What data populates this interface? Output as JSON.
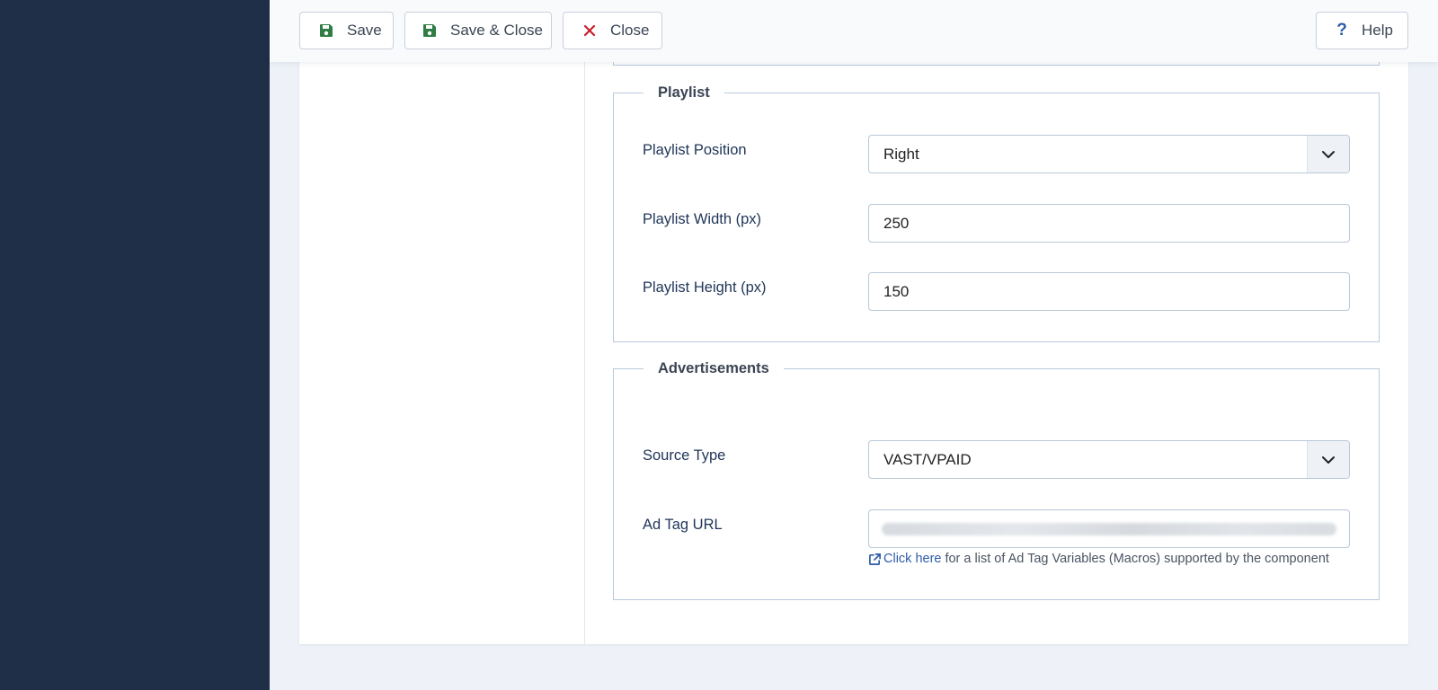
{
  "toolbar": {
    "save_label": "Save",
    "save_close_label": "Save & Close",
    "close_label": "Close",
    "help_label": "Help"
  },
  "playlist": {
    "legend": "Playlist",
    "position": {
      "label": "Playlist Position",
      "value": "Right"
    },
    "width": {
      "label": "Playlist Width (px)",
      "value": "250"
    },
    "height": {
      "label": "Playlist Height (px)",
      "value": "150"
    }
  },
  "advertisements": {
    "legend": "Advertisements",
    "source_type": {
      "label": "Source Type",
      "value": "VAST/VPAID"
    },
    "ad_tag_url": {
      "label": "Ad Tag URL",
      "value": ""
    },
    "help_link": "Click here",
    "help_text": "for a list of Ad Tag Variables (Macros) supported by the component"
  },
  "colors": {
    "sidebar": "#1f2f48",
    "save_icon": "#2f7d44",
    "close_icon": "#c7202a",
    "link": "#2e5ba8",
    "label": "#1f3558"
  }
}
